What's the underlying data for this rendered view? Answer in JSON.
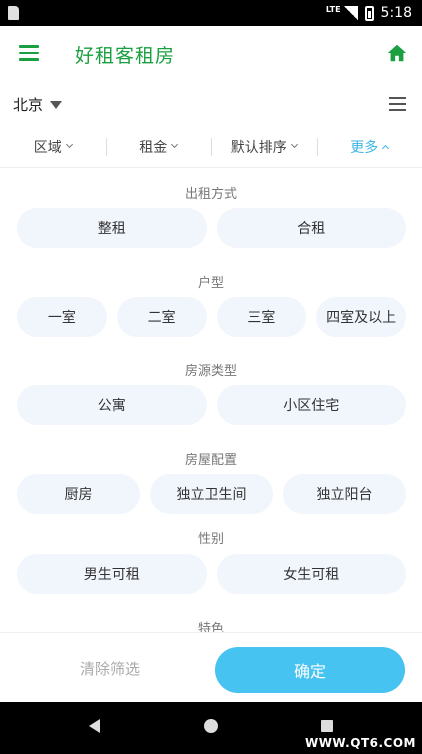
{
  "status_bar": {
    "network": "LTE",
    "time": "5:18"
  },
  "app_bar": {
    "title": "好租客租房"
  },
  "city_row": {
    "city": "北京"
  },
  "filter_tabs": [
    {
      "label": "区域"
    },
    {
      "label": "租金"
    },
    {
      "label": "默认排序"
    },
    {
      "label": "更多"
    }
  ],
  "sections": {
    "rent_type": {
      "title": "出租方式",
      "options": [
        "整租",
        "合租"
      ]
    },
    "layout": {
      "title": "户型",
      "options": [
        "一室",
        "二室",
        "三室",
        "四室及以上"
      ]
    },
    "housing_type": {
      "title": "房源类型",
      "options": [
        "公寓",
        "小区住宅"
      ]
    },
    "config": {
      "title": "房屋配置",
      "options": [
        "厨房",
        "独立卫生间",
        "独立阳台"
      ]
    },
    "gender": {
      "title": "性别",
      "options": [
        "男生可租",
        "女生可租"
      ]
    },
    "features": {
      "title": "特色"
    }
  },
  "actions": {
    "clear_label": "清除筛选",
    "confirm_label": "确定"
  },
  "watermark": "WWW.QT6.COM",
  "colors": {
    "brand_green": "#1aa040",
    "accent_blue": "#3cb5e8",
    "confirm_blue": "#46c3f1",
    "chip_bg": "#f1f5fc"
  }
}
